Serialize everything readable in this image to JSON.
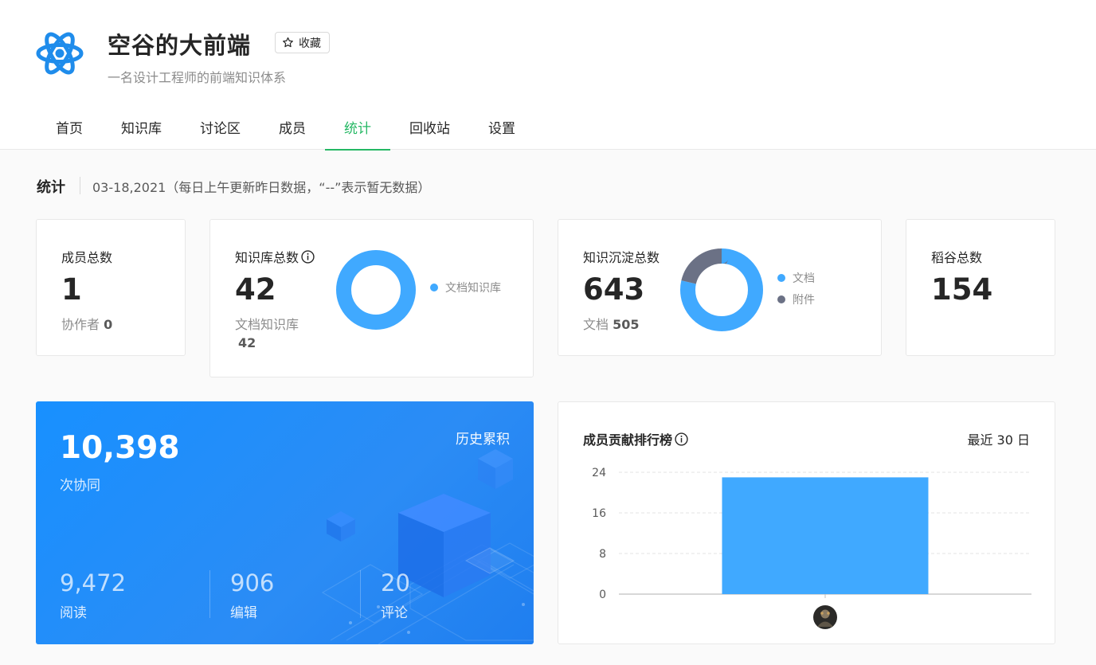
{
  "header": {
    "title": "空谷的大前端",
    "favorite_label": "收藏",
    "subtitle": "一名设计工程师的前端知识体系",
    "brand_color": "#25b864",
    "logo_icon": "react-atom-icon"
  },
  "tabs": [
    {
      "label": "首页",
      "active": false
    },
    {
      "label": "知识库",
      "active": false
    },
    {
      "label": "讨论区",
      "active": false
    },
    {
      "label": "成员",
      "active": false
    },
    {
      "label": "统计",
      "active": true
    },
    {
      "label": "回收站",
      "active": false
    },
    {
      "label": "设置",
      "active": false
    }
  ],
  "stats_header": {
    "title": "统计",
    "date_note": "03-18,2021（每日上午更新昨日数据，“--”表示暂无数据）"
  },
  "cards": {
    "members": {
      "label": "成员总数",
      "value": "1",
      "sub_label": "协作者",
      "sub_value": "0"
    },
    "repos": {
      "label": "知识库总数",
      "value": "42",
      "sub_label": "文档知识库",
      "sub_value": "42",
      "legend": [
        {
          "label": "文档知识库",
          "color": "#40a9ff",
          "value": 42
        }
      ]
    },
    "docs": {
      "label": "知识沉淀总数",
      "value": "643",
      "sub_label": "文档",
      "sub_value": "505",
      "legend": [
        {
          "label": "文档",
          "color": "#40a9ff",
          "value": 505
        },
        {
          "label": "附件",
          "color": "#6b7185",
          "value": 138
        }
      ]
    },
    "daogu": {
      "label": "稻谷总数",
      "value": "154"
    }
  },
  "collab": {
    "value": "10,398",
    "label": "次协同",
    "history_label": "历史累积",
    "metrics": [
      {
        "value": "9,472",
        "label": "阅读"
      },
      {
        "value": "906",
        "label": "编辑"
      },
      {
        "value": "20",
        "label": "评论"
      }
    ]
  },
  "ranking": {
    "title": "成员贡献排行榜",
    "period": "最近 30 日"
  },
  "chart_data": {
    "type": "bar",
    "title": "成员贡献排行榜",
    "categories": [
      "member-avatar"
    ],
    "values": [
      23
    ],
    "ylim": [
      0,
      24
    ],
    "yticks": [
      "0",
      "8",
      "16",
      "24"
    ],
    "grid": true,
    "bar_color": "#40a9ff"
  }
}
